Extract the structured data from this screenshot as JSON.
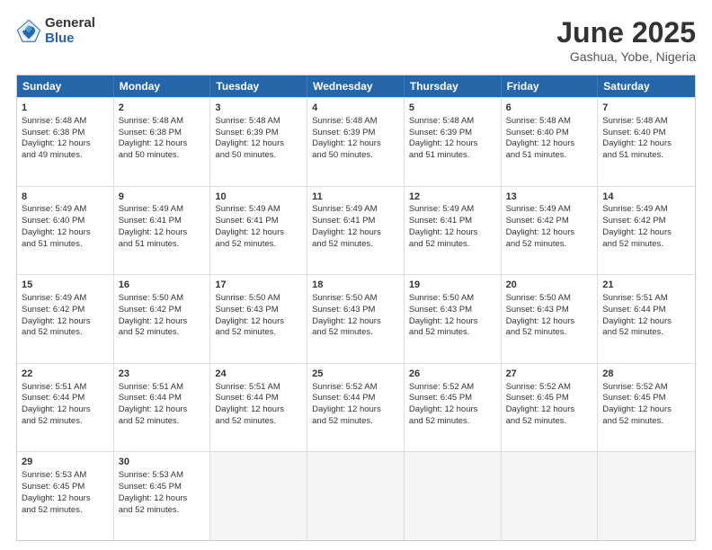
{
  "logo": {
    "general": "General",
    "blue": "Blue"
  },
  "title": "June 2025",
  "subtitle": "Gashua, Yobe, Nigeria",
  "days": [
    "Sunday",
    "Monday",
    "Tuesday",
    "Wednesday",
    "Thursday",
    "Friday",
    "Saturday"
  ],
  "weeks": [
    [
      {
        "num": "1",
        "lines": [
          "Sunrise: 5:48 AM",
          "Sunset: 6:38 PM",
          "Daylight: 12 hours",
          "and 49 minutes."
        ]
      },
      {
        "num": "2",
        "lines": [
          "Sunrise: 5:48 AM",
          "Sunset: 6:38 PM",
          "Daylight: 12 hours",
          "and 50 minutes."
        ]
      },
      {
        "num": "3",
        "lines": [
          "Sunrise: 5:48 AM",
          "Sunset: 6:39 PM",
          "Daylight: 12 hours",
          "and 50 minutes."
        ]
      },
      {
        "num": "4",
        "lines": [
          "Sunrise: 5:48 AM",
          "Sunset: 6:39 PM",
          "Daylight: 12 hours",
          "and 50 minutes."
        ]
      },
      {
        "num": "5",
        "lines": [
          "Sunrise: 5:48 AM",
          "Sunset: 6:39 PM",
          "Daylight: 12 hours",
          "and 51 minutes."
        ]
      },
      {
        "num": "6",
        "lines": [
          "Sunrise: 5:48 AM",
          "Sunset: 6:40 PM",
          "Daylight: 12 hours",
          "and 51 minutes."
        ]
      },
      {
        "num": "7",
        "lines": [
          "Sunrise: 5:48 AM",
          "Sunset: 6:40 PM",
          "Daylight: 12 hours",
          "and 51 minutes."
        ]
      }
    ],
    [
      {
        "num": "8",
        "lines": [
          "Sunrise: 5:49 AM",
          "Sunset: 6:40 PM",
          "Daylight: 12 hours",
          "and 51 minutes."
        ]
      },
      {
        "num": "9",
        "lines": [
          "Sunrise: 5:49 AM",
          "Sunset: 6:41 PM",
          "Daylight: 12 hours",
          "and 51 minutes."
        ]
      },
      {
        "num": "10",
        "lines": [
          "Sunrise: 5:49 AM",
          "Sunset: 6:41 PM",
          "Daylight: 12 hours",
          "and 52 minutes."
        ]
      },
      {
        "num": "11",
        "lines": [
          "Sunrise: 5:49 AM",
          "Sunset: 6:41 PM",
          "Daylight: 12 hours",
          "and 52 minutes."
        ]
      },
      {
        "num": "12",
        "lines": [
          "Sunrise: 5:49 AM",
          "Sunset: 6:41 PM",
          "Daylight: 12 hours",
          "and 52 minutes."
        ]
      },
      {
        "num": "13",
        "lines": [
          "Sunrise: 5:49 AM",
          "Sunset: 6:42 PM",
          "Daylight: 12 hours",
          "and 52 minutes."
        ]
      },
      {
        "num": "14",
        "lines": [
          "Sunrise: 5:49 AM",
          "Sunset: 6:42 PM",
          "Daylight: 12 hours",
          "and 52 minutes."
        ]
      }
    ],
    [
      {
        "num": "15",
        "lines": [
          "Sunrise: 5:49 AM",
          "Sunset: 6:42 PM",
          "Daylight: 12 hours",
          "and 52 minutes."
        ]
      },
      {
        "num": "16",
        "lines": [
          "Sunrise: 5:50 AM",
          "Sunset: 6:42 PM",
          "Daylight: 12 hours",
          "and 52 minutes."
        ]
      },
      {
        "num": "17",
        "lines": [
          "Sunrise: 5:50 AM",
          "Sunset: 6:43 PM",
          "Daylight: 12 hours",
          "and 52 minutes."
        ]
      },
      {
        "num": "18",
        "lines": [
          "Sunrise: 5:50 AM",
          "Sunset: 6:43 PM",
          "Daylight: 12 hours",
          "and 52 minutes."
        ]
      },
      {
        "num": "19",
        "lines": [
          "Sunrise: 5:50 AM",
          "Sunset: 6:43 PM",
          "Daylight: 12 hours",
          "and 52 minutes."
        ]
      },
      {
        "num": "20",
        "lines": [
          "Sunrise: 5:50 AM",
          "Sunset: 6:43 PM",
          "Daylight: 12 hours",
          "and 52 minutes."
        ]
      },
      {
        "num": "21",
        "lines": [
          "Sunrise: 5:51 AM",
          "Sunset: 6:44 PM",
          "Daylight: 12 hours",
          "and 52 minutes."
        ]
      }
    ],
    [
      {
        "num": "22",
        "lines": [
          "Sunrise: 5:51 AM",
          "Sunset: 6:44 PM",
          "Daylight: 12 hours",
          "and 52 minutes."
        ]
      },
      {
        "num": "23",
        "lines": [
          "Sunrise: 5:51 AM",
          "Sunset: 6:44 PM",
          "Daylight: 12 hours",
          "and 52 minutes."
        ]
      },
      {
        "num": "24",
        "lines": [
          "Sunrise: 5:51 AM",
          "Sunset: 6:44 PM",
          "Daylight: 12 hours",
          "and 52 minutes."
        ]
      },
      {
        "num": "25",
        "lines": [
          "Sunrise: 5:52 AM",
          "Sunset: 6:44 PM",
          "Daylight: 12 hours",
          "and 52 minutes."
        ]
      },
      {
        "num": "26",
        "lines": [
          "Sunrise: 5:52 AM",
          "Sunset: 6:45 PM",
          "Daylight: 12 hours",
          "and 52 minutes."
        ]
      },
      {
        "num": "27",
        "lines": [
          "Sunrise: 5:52 AM",
          "Sunset: 6:45 PM",
          "Daylight: 12 hours",
          "and 52 minutes."
        ]
      },
      {
        "num": "28",
        "lines": [
          "Sunrise: 5:52 AM",
          "Sunset: 6:45 PM",
          "Daylight: 12 hours",
          "and 52 minutes."
        ]
      }
    ],
    [
      {
        "num": "29",
        "lines": [
          "Sunrise: 5:53 AM",
          "Sunset: 6:45 PM",
          "Daylight: 12 hours",
          "and 52 minutes."
        ]
      },
      {
        "num": "30",
        "lines": [
          "Sunrise: 5:53 AM",
          "Sunset: 6:45 PM",
          "Daylight: 12 hours",
          "and 52 minutes."
        ]
      },
      {
        "num": "",
        "lines": []
      },
      {
        "num": "",
        "lines": []
      },
      {
        "num": "",
        "lines": []
      },
      {
        "num": "",
        "lines": []
      },
      {
        "num": "",
        "lines": []
      }
    ]
  ]
}
